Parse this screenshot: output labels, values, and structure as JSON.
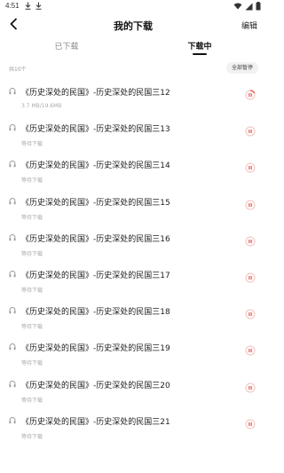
{
  "status_bar": {
    "time": "4:51"
  },
  "header": {
    "title": "我的下载",
    "edit_label": "编辑"
  },
  "tabs": [
    {
      "label": "已下载",
      "active": false
    },
    {
      "label": "下载中",
      "active": true
    }
  ],
  "summary": {
    "count_text": "共10个",
    "pause_all_label": "全部暂停"
  },
  "downloads": [
    {
      "title": "《历史深处的民国》-历史深处的民国三12",
      "status": "3.7 MB/19.6MB",
      "progress": 0.19
    },
    {
      "title": "《历史深处的民国》-历史深处的民国三13",
      "status": "等待下载",
      "progress": 0
    },
    {
      "title": "《历史深处的民国》-历史深处的民国三14",
      "status": "等待下载",
      "progress": 0
    },
    {
      "title": "《历史深处的民国》-历史深处的民国三15",
      "status": "等待下载",
      "progress": 0
    },
    {
      "title": "《历史深处的民国》-历史深处的民国三16",
      "status": "等待下载",
      "progress": 0
    },
    {
      "title": "《历史深处的民国》-历史深处的民国三17",
      "status": "等待下载",
      "progress": 0
    },
    {
      "title": "《历史深处的民国》-历史深处的民国三18",
      "status": "等待下载",
      "progress": 0
    },
    {
      "title": "《历史深处的民国》-历史深处的民国三19",
      "status": "等待下载",
      "progress": 0
    },
    {
      "title": "《历史深处的民国》-历史深处的民国三20",
      "status": "等待下载",
      "progress": 0
    },
    {
      "title": "《历史深处的民国》-历史深处的民国三21",
      "status": "等待下载",
      "progress": 0
    }
  ],
  "colors": {
    "accent": "#e8453c",
    "ring_track": "#f3c2bf",
    "text": "#222222",
    "muted": "#aaaaaa"
  },
  "icons": {
    "back": "chevron-left-icon",
    "item": "headphones-icon",
    "action": "pause-icon"
  }
}
